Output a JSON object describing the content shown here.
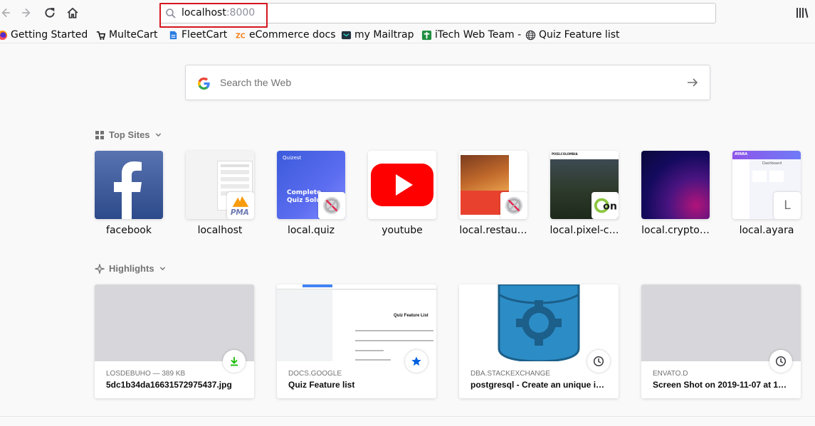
{
  "toolbar": {
    "url_host": "localhost",
    "url_port": ":8000",
    "icons": [
      "back-icon",
      "forward-icon",
      "reload-icon",
      "home-icon",
      "search-icon",
      "library-icon"
    ]
  },
  "bookmarks": [
    {
      "label": "Getting Started",
      "icon": "firefox-icon"
    },
    {
      "label": "MulteCart",
      "icon": "multecart-icon"
    },
    {
      "label": "FleetCart",
      "icon": "fleetcart-icon"
    },
    {
      "label": "eCommerce docs",
      "icon": "ecommerce-docs-icon"
    },
    {
      "label": "my Mailtrap",
      "icon": "mailtrap-icon"
    },
    {
      "label": "iTech Web Team -",
      "icon": "itech-icon"
    },
    {
      "label": "Quiz Feature list",
      "icon": "globe-icon"
    }
  ],
  "search": {
    "placeholder": "Search the Web"
  },
  "top_sites": {
    "title": "Top Sites",
    "tiles": [
      {
        "label": "facebook"
      },
      {
        "label": "localhost"
      },
      {
        "label": "local.quiz"
      },
      {
        "label": "youtube"
      },
      {
        "label": "local.restau…"
      },
      {
        "label": "local.pixel-c…"
      },
      {
        "label": "local.crypto…"
      },
      {
        "label": "local.ayara"
      }
    ],
    "thumb_text": {
      "pma": "PMA",
      "quiz_brand": "Quizest",
      "quiz_heading": "Complete Quiz Solution",
      "pixel_brand": "PIXELCOLOMBIA",
      "ayara_brand": "AYARA",
      "ayara_heading": "Dashboard",
      "ayara_letter": "L",
      "pixel_badge": "on"
    }
  },
  "highlights": {
    "title": "Highlights",
    "cards": [
      {
        "source": "LOSDEBUHO — 389 KB",
        "title": "5dc1b34da16631572975437.jpg",
        "badge": "download-icon"
      },
      {
        "source": "DOCS.GOOGLE",
        "title": "Quiz Feature list",
        "badge": "bookmark-star-icon",
        "thumb_heading": "Quiz Feature List"
      },
      {
        "source": "DBA.STACKEXCHANGE",
        "title": "postgresql - Create an unique i…",
        "badge": "history-clock-icon"
      },
      {
        "source": "ENVATO.D",
        "title": "Screen Shot on 2019-11-07 at 1…",
        "badge": "history-clock-icon"
      }
    ]
  },
  "colors": {
    "url_highlight": "#d5161d",
    "facebook": "#3b5998",
    "youtube": "#ff0000",
    "accent_blue": "#0060df",
    "download_green": "#12bc00"
  }
}
